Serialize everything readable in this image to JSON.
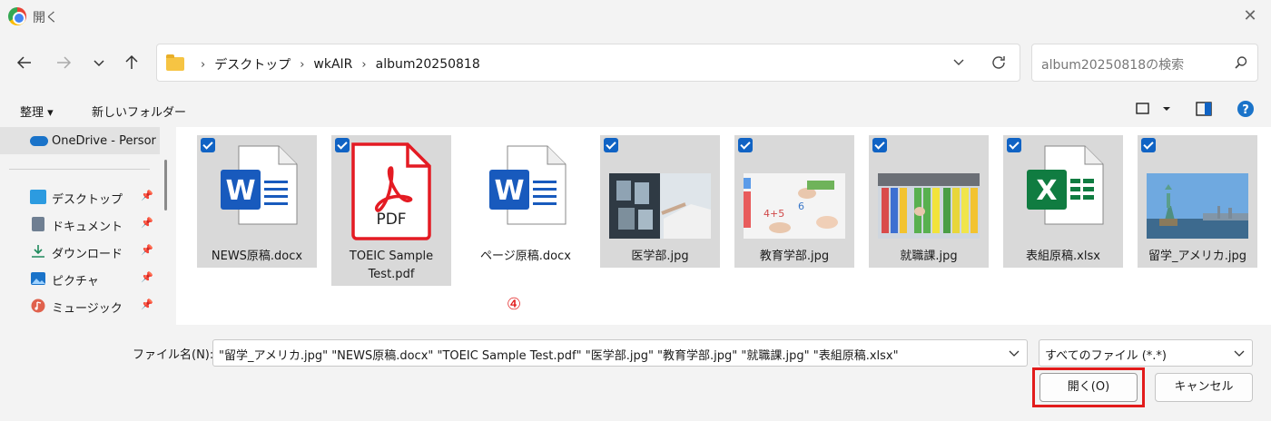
{
  "window": {
    "title": "開く",
    "close_label": "✕"
  },
  "nav": {
    "breadcrumbs": [
      "デスクトップ",
      "wkAIR",
      "album20250818"
    ],
    "search_placeholder": "album20250818の検索"
  },
  "toolbar": {
    "organize": "整理 ▾",
    "new_folder": "新しいフォルダー"
  },
  "sidebar": {
    "onedrive": "OneDrive - Persor",
    "quick_access": [
      {
        "label": "デスクトップ",
        "icon": "desktop-icon"
      },
      {
        "label": "ドキュメント",
        "icon": "documents-icon"
      },
      {
        "label": "ダウンロード",
        "icon": "download-icon"
      },
      {
        "label": "ピクチャ",
        "icon": "pictures-icon"
      },
      {
        "label": "ミュージック",
        "icon": "music-icon"
      }
    ]
  },
  "files": [
    {
      "name": "NEWS原稿.docx",
      "type": "word",
      "selected": true
    },
    {
      "name": "TOEIC Sample Test.pdf",
      "name_line1": "TOEIC Sample",
      "name_line2": "Test.pdf",
      "type": "pdf",
      "selected": true
    },
    {
      "name": "ページ原稿.docx",
      "type": "word",
      "selected": false
    },
    {
      "name": "医学部.jpg",
      "type": "image",
      "selected": true
    },
    {
      "name": "教育学部.jpg",
      "type": "image",
      "selected": true
    },
    {
      "name": "就職課.jpg",
      "type": "image",
      "selected": true
    },
    {
      "name": "表組原稿.xlsx",
      "type": "excel",
      "selected": true
    },
    {
      "name": "留学_アメリカ.jpg",
      "type": "image",
      "selected": true
    }
  ],
  "pdf_label": "PDF",
  "annotation": "④",
  "bottom": {
    "filename_label": "ファイル名(N):",
    "filename_value": "\"留学_アメリカ.jpg\" \"NEWS原稿.docx\" \"TOEIC Sample Test.pdf\" \"医学部.jpg\" \"教育学部.jpg\" \"就職課.jpg\" \"表組原稿.xlsx\"",
    "filetype": "すべてのファイル (*.*)",
    "open_button": "開く(O)",
    "cancel_button": "キャンセル"
  },
  "colors": {
    "accent": "#1063c4",
    "highlight": "#e21b1b",
    "word": "#185abd",
    "excel": "#107c41",
    "pdf": "#e41b23"
  }
}
